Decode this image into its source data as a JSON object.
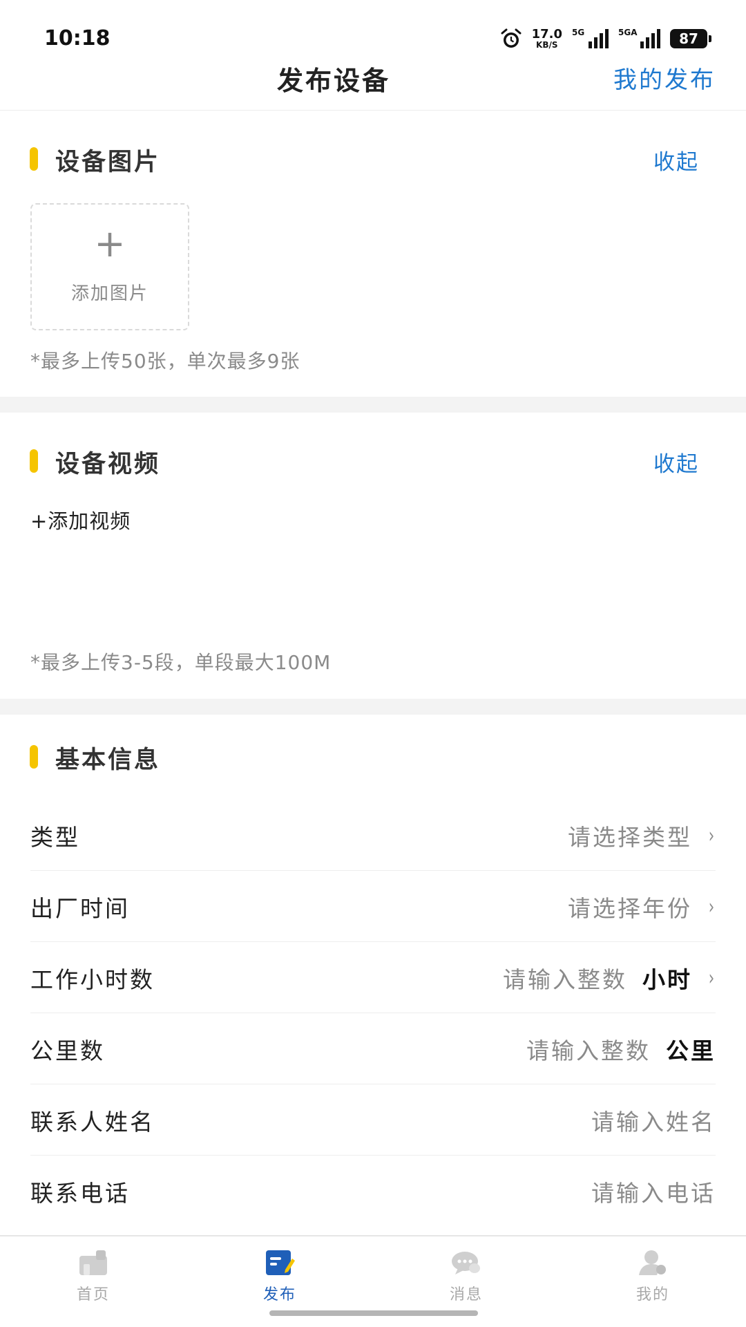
{
  "status_bar": {
    "time": "10:18",
    "net_speed_value": "17.0",
    "net_speed_unit": "KB/S",
    "sim1_tag": "5G",
    "sim2_tag": "5GA",
    "battery": "87"
  },
  "header": {
    "title": "发布设备",
    "action": "我的发布"
  },
  "photos": {
    "title": "设备图片",
    "collapse": "收起",
    "add_icon": "+",
    "add_label": "添加图片",
    "hint": "*最多上传50张，单次最多9张"
  },
  "videos": {
    "title": "设备视频",
    "collapse": "收起",
    "add_label": "+添加视频",
    "hint": "*最多上传3-5段，单段最大100M"
  },
  "basic": {
    "title": "基本信息",
    "rows": [
      {
        "label": "类型",
        "placeholder": "请选择类型",
        "unit": "",
        "chevron": "›"
      },
      {
        "label": "出厂时间",
        "placeholder": "请选择年份",
        "unit": "",
        "chevron": "›"
      },
      {
        "label": "工作小时数",
        "placeholder": "请输入整数",
        "unit": "小时",
        "chevron": "›"
      },
      {
        "label": "公里数",
        "placeholder": "请输入整数",
        "unit": "公里",
        "chevron": ""
      },
      {
        "label": "联系人姓名",
        "placeholder": "请输入姓名",
        "unit": "",
        "chevron": ""
      },
      {
        "label": "联系电话",
        "placeholder": "请输入电话",
        "unit": "",
        "chevron": ""
      }
    ]
  },
  "tabbar": {
    "items": [
      {
        "label": "首页",
        "icon": "home-icon",
        "active": false
      },
      {
        "label": "发布",
        "icon": "publish-icon",
        "active": true
      },
      {
        "label": "消息",
        "icon": "message-icon",
        "active": false
      },
      {
        "label": "我的",
        "icon": "profile-icon",
        "active": false
      }
    ]
  },
  "colors": {
    "accent_blue": "#1f79cf",
    "section_marker": "#f5c400",
    "active_tab": "#1f5fb8"
  }
}
